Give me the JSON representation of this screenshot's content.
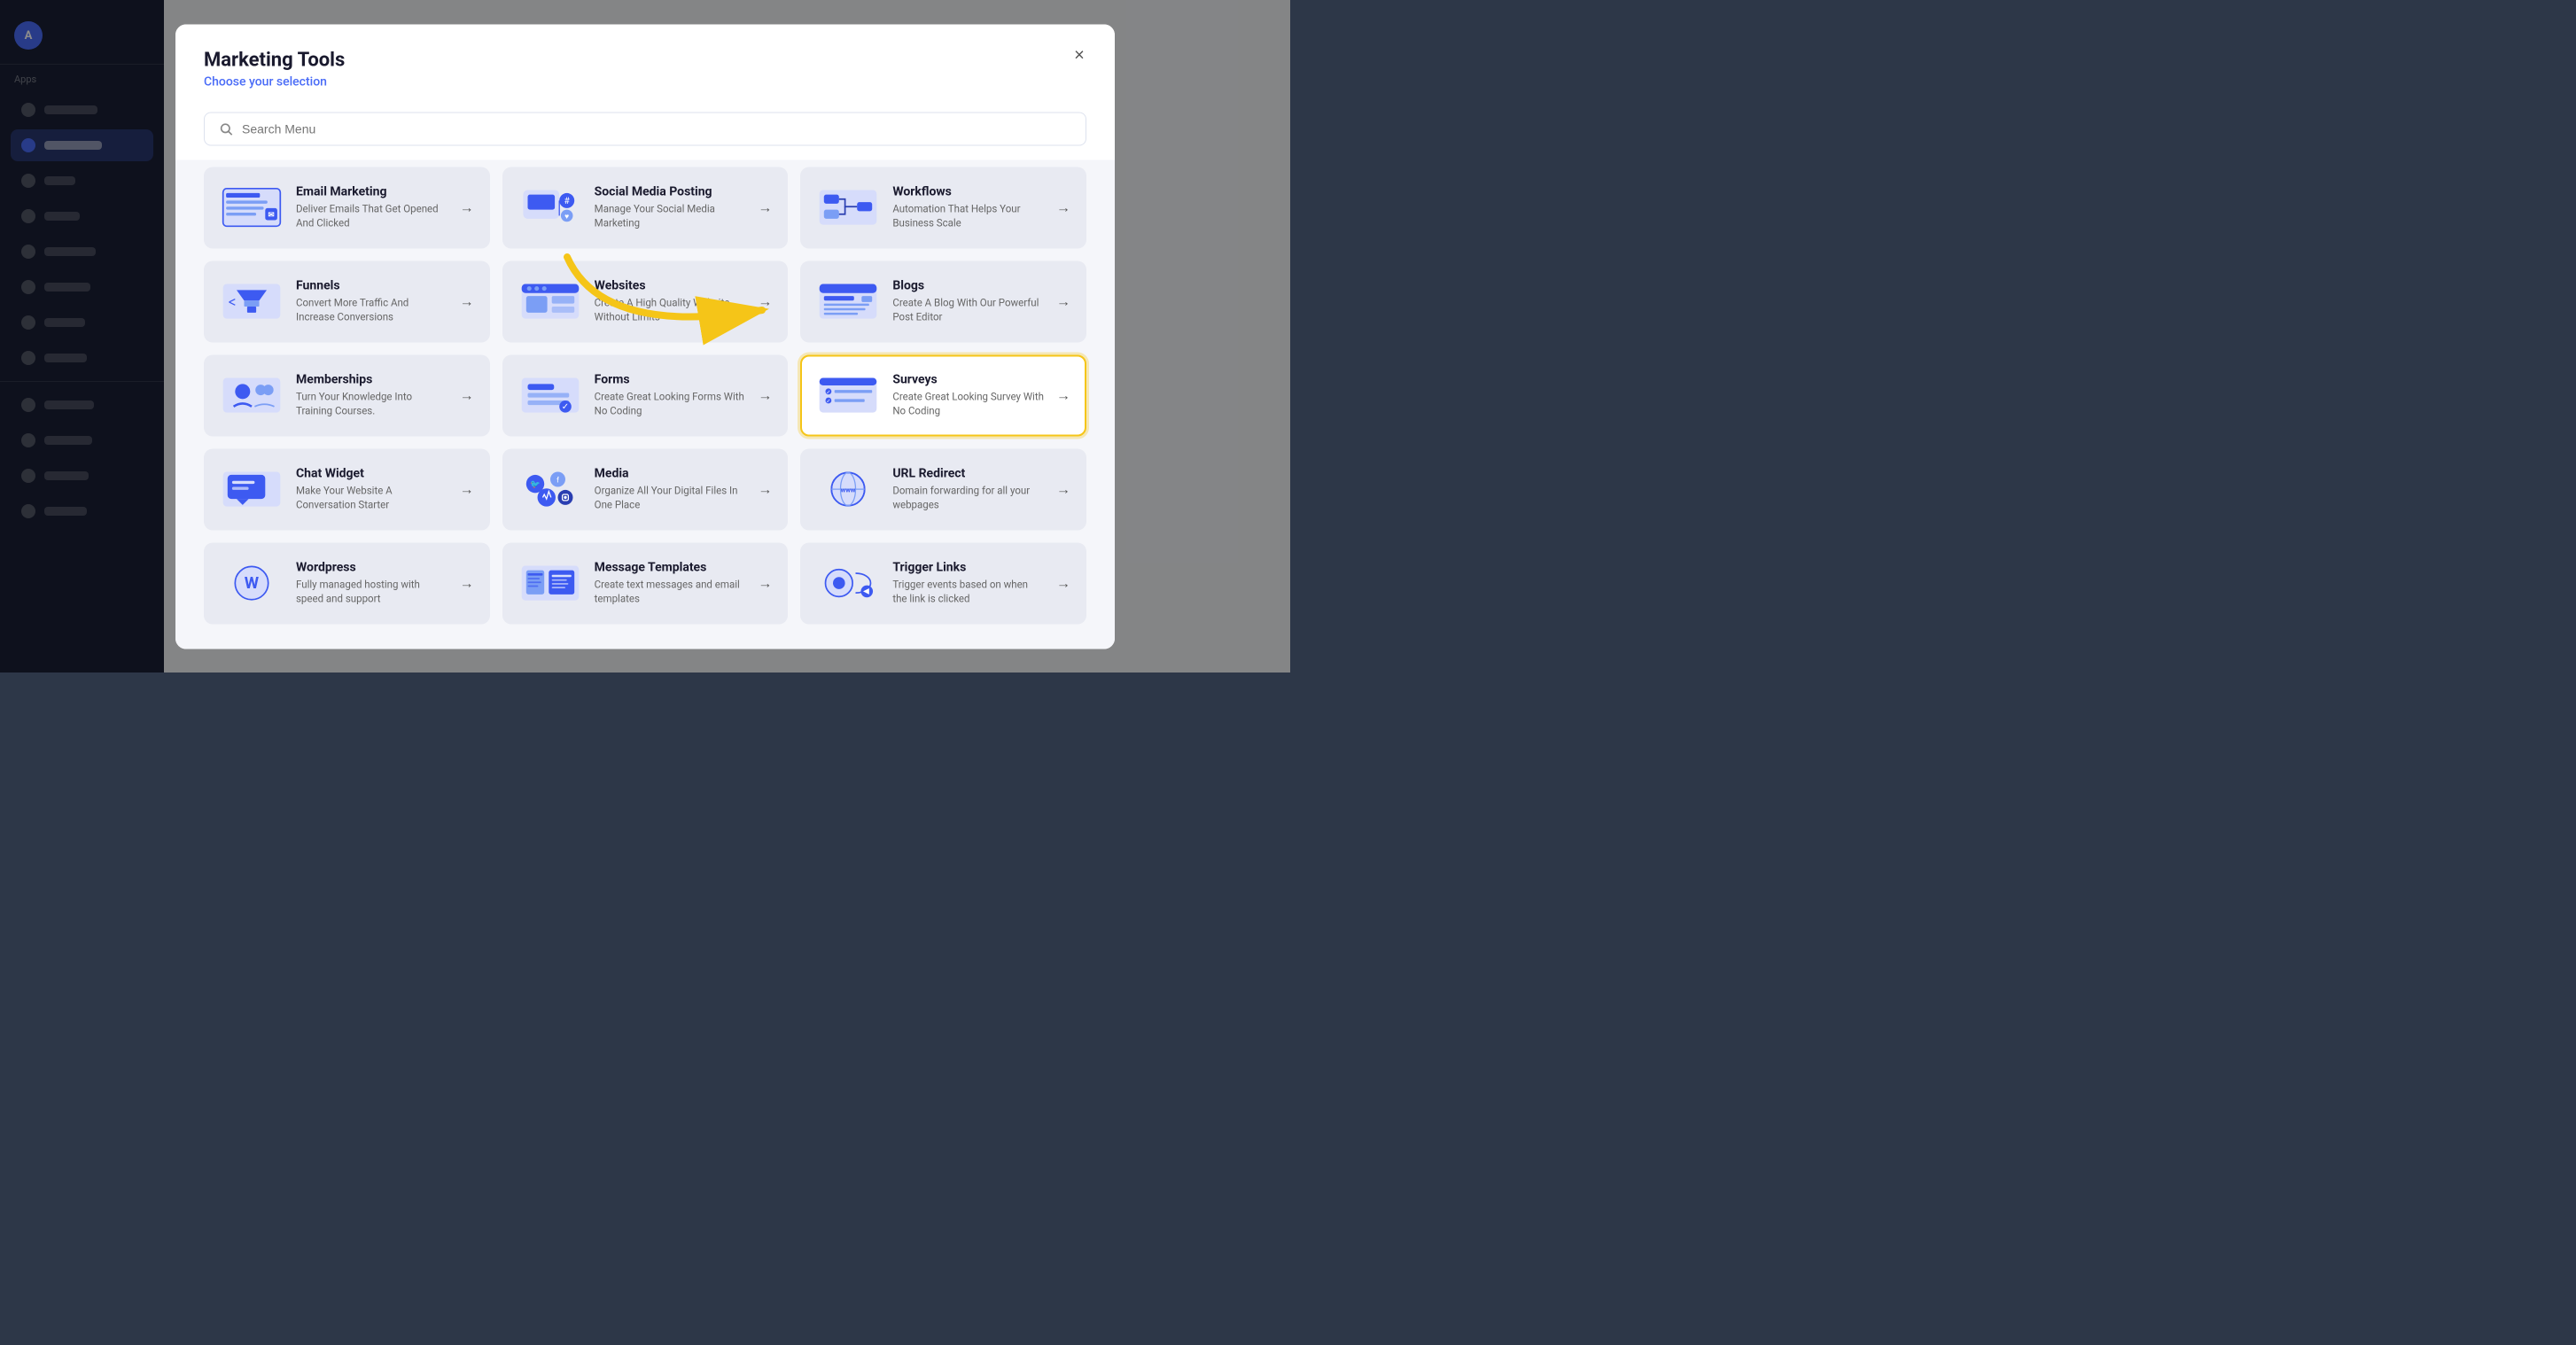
{
  "modal": {
    "title": "Marketing Tools",
    "subtitle": "Choose your selection",
    "close_label": "×"
  },
  "search": {
    "placeholder": "Search Menu"
  },
  "cards": [
    {
      "id": "email-marketing",
      "title": "Email Marketing",
      "desc": "Deliver Emails That Get Opened And Clicked",
      "highlighted": false,
      "icon": "email"
    },
    {
      "id": "social-media",
      "title": "Social Media Posting",
      "desc": "Manage Your Social Media Marketing",
      "highlighted": false,
      "icon": "social"
    },
    {
      "id": "workflows",
      "title": "Workflows",
      "desc": "Automation That Helps Your Business Scale",
      "highlighted": false,
      "icon": "workflow"
    },
    {
      "id": "funnels",
      "title": "Funnels",
      "desc": "Convert More Traffic And Increase Conversions",
      "highlighted": false,
      "icon": "funnel"
    },
    {
      "id": "websites",
      "title": "Websites",
      "desc": "Create A High Quality Website Without Limits",
      "highlighted": false,
      "icon": "website"
    },
    {
      "id": "blogs",
      "title": "Blogs",
      "desc": "Create A Blog With Our Powerful Post Editor",
      "highlighted": false,
      "icon": "blog"
    },
    {
      "id": "memberships",
      "title": "Memberships",
      "desc": "Turn Your Knowledge Into Training Courses.",
      "highlighted": false,
      "icon": "membership"
    },
    {
      "id": "forms",
      "title": "Forms",
      "desc": "Create Great Looking Forms With No Coding",
      "highlighted": false,
      "icon": "forms"
    },
    {
      "id": "surveys",
      "title": "Surveys",
      "desc": "Create Great Looking Survey With No Coding",
      "highlighted": true,
      "icon": "surveys"
    },
    {
      "id": "chat-widget",
      "title": "Chat Widget",
      "desc": "Make Your Website A Conversation Starter",
      "highlighted": false,
      "icon": "chat"
    },
    {
      "id": "media",
      "title": "Media",
      "desc": "Organize All Your Digital Files In One Place",
      "highlighted": false,
      "icon": "media"
    },
    {
      "id": "url-redirect",
      "title": "URL Redirect",
      "desc": "Domain forwarding for all your webpages",
      "highlighted": false,
      "icon": "url"
    },
    {
      "id": "wordpress",
      "title": "Wordpress",
      "desc": "Fully managed hosting with speed and support",
      "highlighted": false,
      "icon": "wordpress"
    },
    {
      "id": "message-templates",
      "title": "Message Templates",
      "desc": "Create text messages and email templates",
      "highlighted": false,
      "icon": "message"
    },
    {
      "id": "trigger-links",
      "title": "Trigger Links",
      "desc": "Trigger events based on when the link is clicked",
      "highlighted": false,
      "icon": "trigger"
    }
  ],
  "arrow_label": "→"
}
